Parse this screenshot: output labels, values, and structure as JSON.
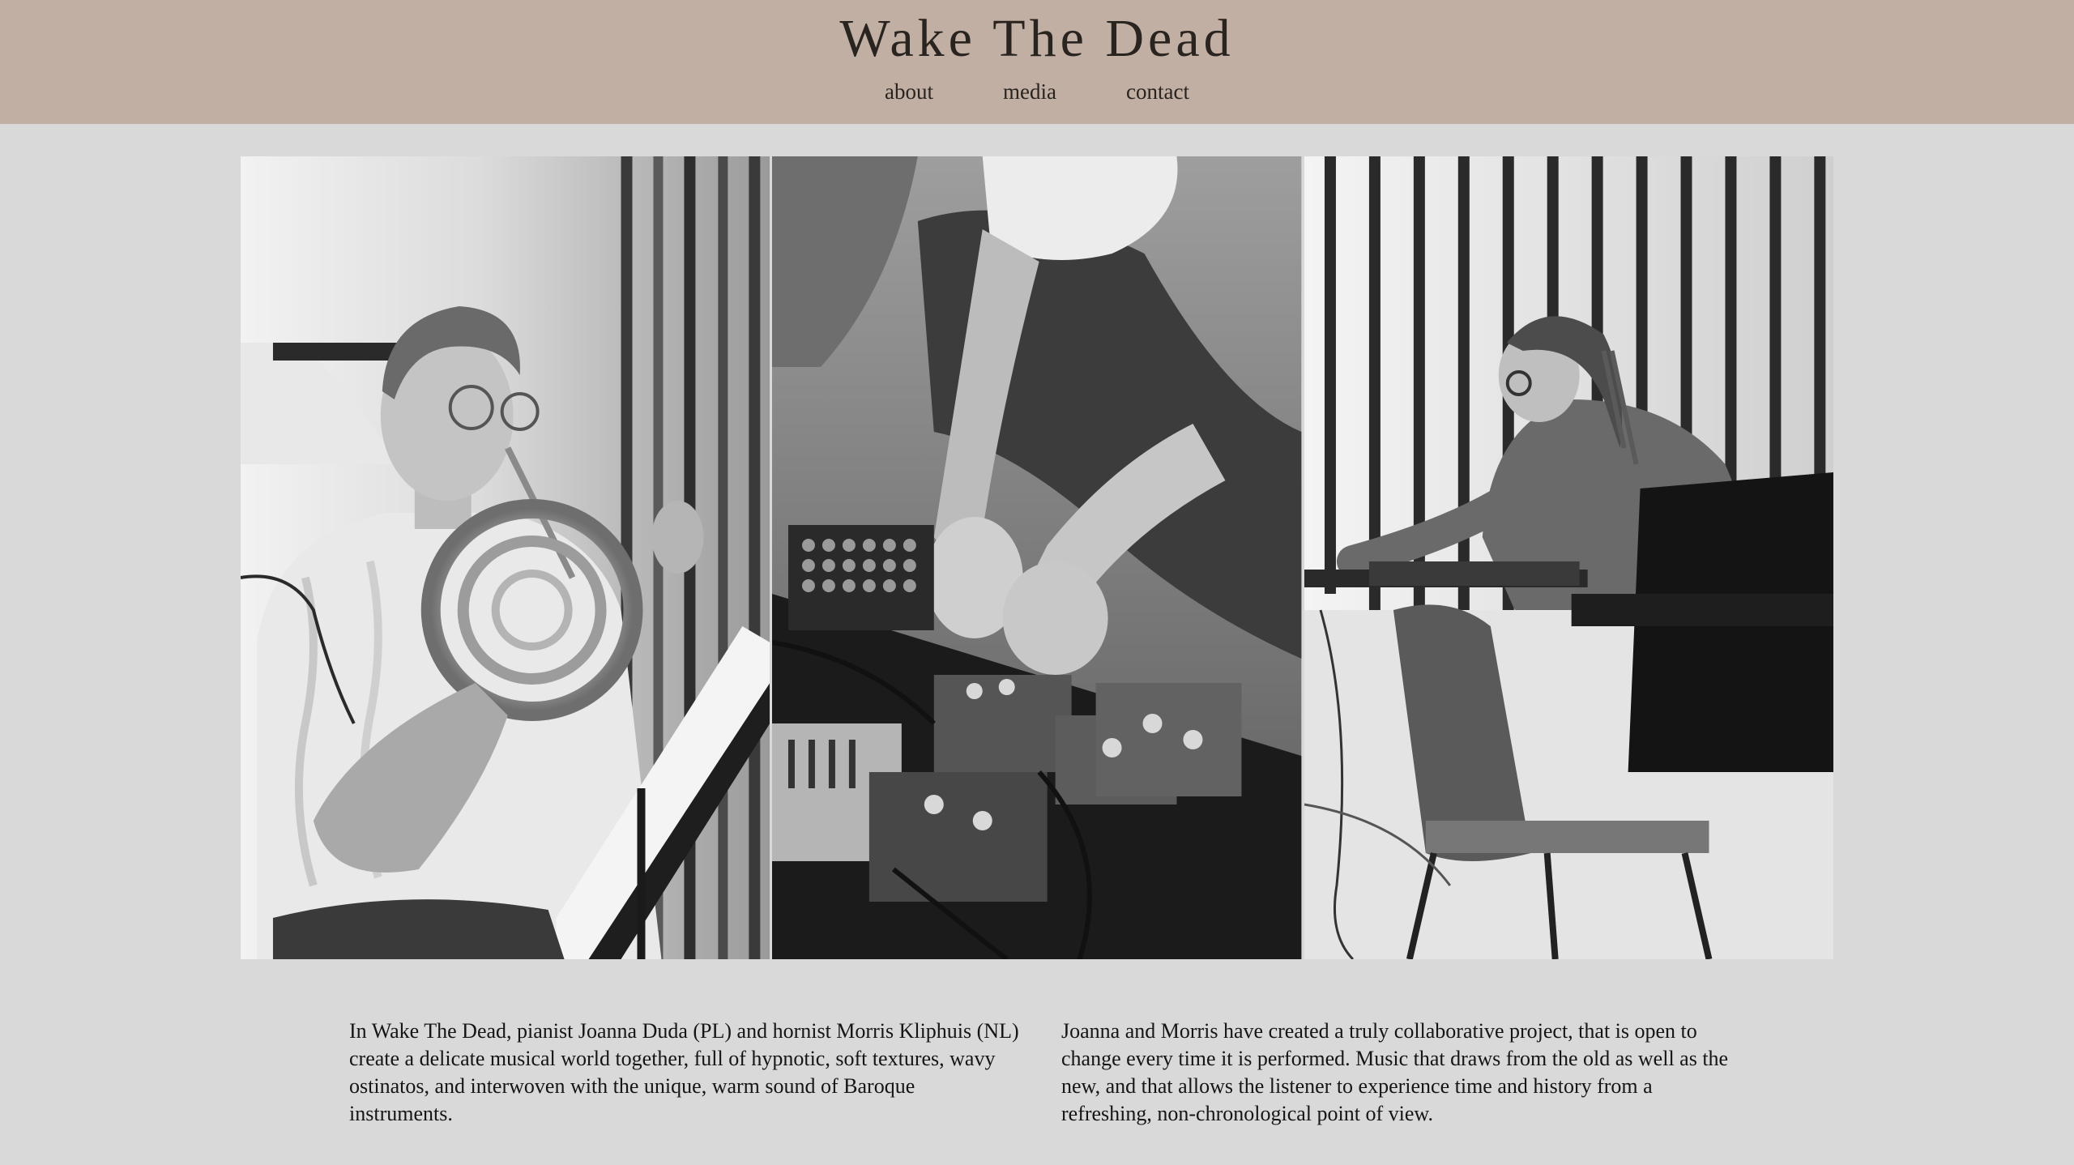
{
  "site": {
    "title": "Wake The Dead"
  },
  "nav": {
    "items": [
      {
        "label": "about"
      },
      {
        "label": "media"
      },
      {
        "label": "contact"
      }
    ]
  },
  "gallery": {
    "photos": [
      {
        "subject": "hornist-photo"
      },
      {
        "subject": "effects-pedals-photo"
      },
      {
        "subject": "pianist-photo"
      }
    ]
  },
  "intro": {
    "left": "In Wake The Dead, pianist Joanna Duda (PL) and hornist Morris Kliphuis (NL) create a delicate musical world together, full of hypnotic, soft textures, wavy ostinatos, and interwoven with the unique, warm sound of Baroque instruments.",
    "right": "Joanna and Morris have created a truly collaborative project, that is open to change every time it is performed. Music that draws from the old as well as the new, and that allows the listener to experience time and history from a refreshing, non-chronological point of view."
  },
  "colors": {
    "header_bg": "#c1afa4",
    "page_bg": "#d9d9d9"
  }
}
